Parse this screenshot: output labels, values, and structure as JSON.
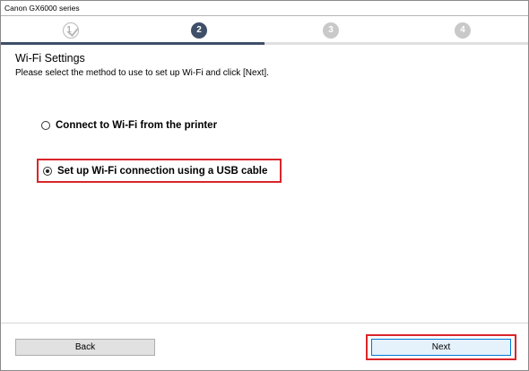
{
  "window": {
    "title": "Canon GX6000 series"
  },
  "steps": [
    {
      "label": "1",
      "state": "done"
    },
    {
      "label": "2",
      "state": "active"
    },
    {
      "label": "3",
      "state": "pending"
    },
    {
      "label": "4",
      "state": "pending"
    }
  ],
  "progress": {
    "completed_fraction": 0.5
  },
  "content": {
    "heading": "Wi-Fi Settings",
    "instruction": "Please select the method to use to set up Wi-Fi and click [Next].",
    "options": [
      {
        "label": "Connect to Wi-Fi from the printer",
        "selected": false
      },
      {
        "label": "Set up Wi-Fi connection using a USB cable",
        "selected": true
      }
    ]
  },
  "buttons": {
    "back": "Back",
    "next": "Next"
  },
  "colors": {
    "accent": "#3f4f68",
    "highlight": "#d9252a",
    "pending": "#c9c9c9"
  }
}
